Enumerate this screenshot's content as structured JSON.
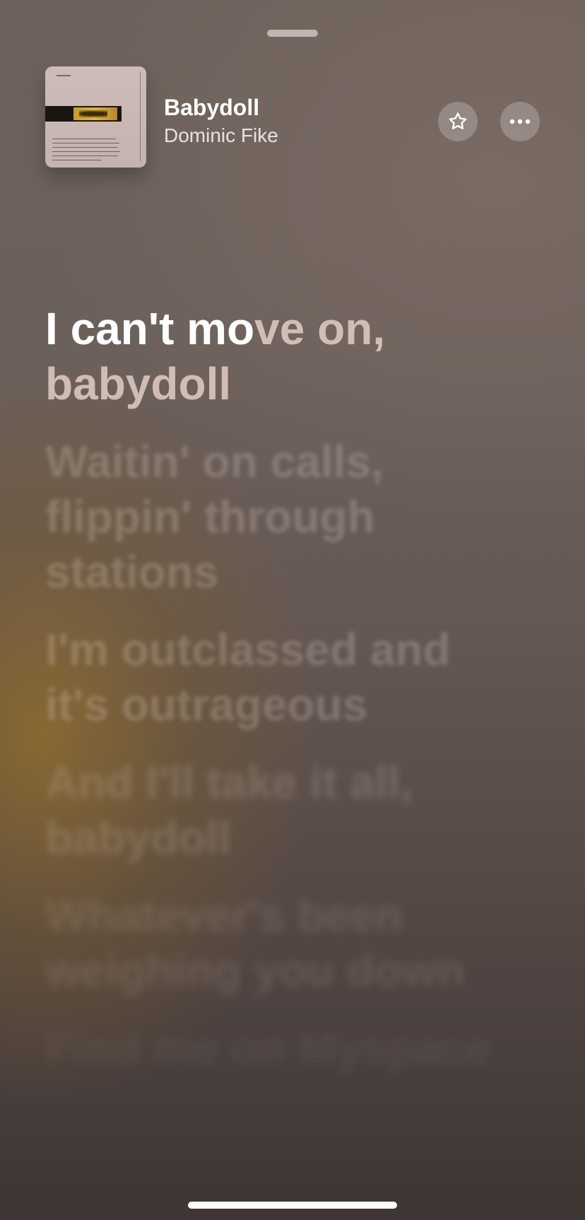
{
  "track": {
    "title": "Babydoll",
    "artist": "Dominic Fike"
  },
  "actions": {
    "favorite_icon": "star-icon",
    "more_icon": "ellipsis-icon"
  },
  "lyrics": {
    "current": {
      "sung": "I can't mo",
      "unsung": "ve on, babydoll"
    },
    "upcoming": [
      "Waitin' on calls, flippin' through stations",
      "I'm outclassed and it's outrageous",
      "And I'll take it all, babydoll",
      "Whatever's been weighing you down",
      "Find me on Myspace"
    ]
  },
  "colors": {
    "accent_yellow": "#e2b441",
    "background_top": "#6e625c",
    "background_bottom": "#3e3533"
  }
}
